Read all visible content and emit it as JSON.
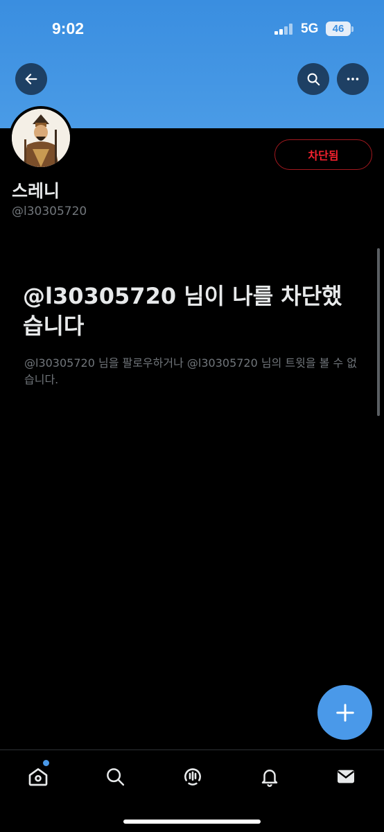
{
  "status_bar": {
    "time": "9:02",
    "network": "5G",
    "battery": "46"
  },
  "profile": {
    "display_name": "스레니",
    "handle": "@l30305720",
    "blocked_button_label": "차단됨"
  },
  "block_notice": {
    "title": "@l30305720 님이 나를 차단했습니다",
    "description": "@l30305720 님을 팔로우하거나 @l30305720 님의 트윗을 볼 수 없습니다."
  },
  "icons": {
    "back": "back-arrow-icon",
    "search": "search-icon",
    "more": "more-icon",
    "compose": "plus-icon",
    "tabs": [
      "home-icon",
      "search-icon",
      "spaces-icon",
      "bell-icon",
      "mail-icon"
    ]
  },
  "colors": {
    "banner": "#4a9be6",
    "accent": "#4a99e9",
    "blocked_red": "#f4212e",
    "secondary_text": "#71767b"
  }
}
